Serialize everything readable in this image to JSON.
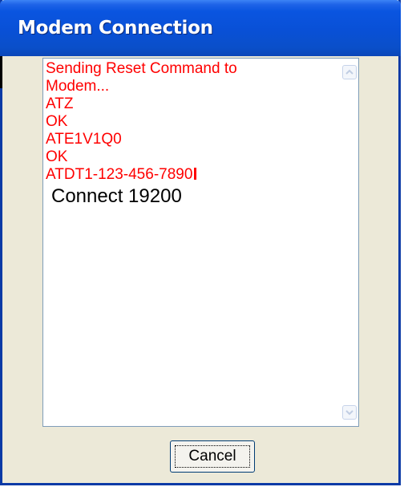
{
  "window": {
    "title": "Modem Connection"
  },
  "log": {
    "lines": [
      "Sending Reset Command to",
      "Modem...",
      "ATZ",
      "OK",
      "ATE1V1Q0",
      "OK",
      "ATDT1-123-456-7890"
    ],
    "status": "Connect 19200"
  },
  "buttons": {
    "cancel_label": "Cancel"
  },
  "colors": {
    "log_text": "#ff0000",
    "status_text": "#000000",
    "titlebar": "#0a55e0"
  },
  "icons": {
    "scroll_up": "chevron-up-icon",
    "scroll_down": "chevron-down-icon"
  }
}
